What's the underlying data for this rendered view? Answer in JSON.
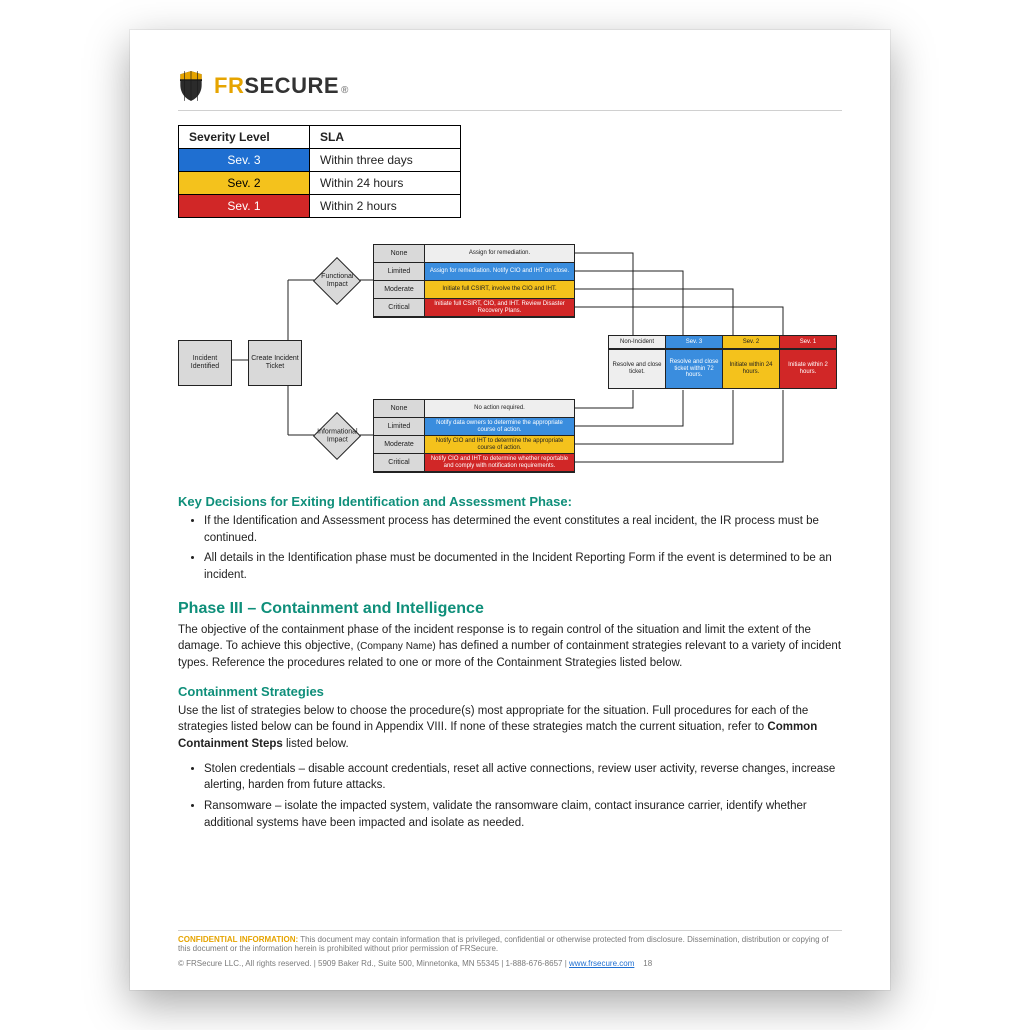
{
  "brand": {
    "fr": "FR",
    "sec": "SECURE",
    "reg": "®"
  },
  "sla_table": {
    "headers": [
      "Severity Level",
      "SLA"
    ],
    "rows": [
      {
        "level": "Sev. 3",
        "sla": "Within three days",
        "class": "sev3"
      },
      {
        "level": "Sev. 2",
        "sla": "Within 24 hours",
        "class": "sev2"
      },
      {
        "level": "Sev. 1",
        "sla": "Within 2 hours",
        "class": "sev1"
      }
    ]
  },
  "flow": {
    "incident_identified": "Incident Identified",
    "create_ticket": "Create Incident Ticket",
    "functional_impact": "Functional Impact",
    "informational_impact": "Informational Impact",
    "impact_levels": [
      "None",
      "Limited",
      "Moderate",
      "Critical"
    ],
    "functional_actions": [
      "Assign for remediation.",
      "Assign for remediation. Notify CIO and IHT on close.",
      "Initiate full CSIRT, involve the CIO and IHT.",
      "Initiate full CSIRT, CIO, and IHT. Review Disaster Recovery Plans."
    ],
    "informational_actions": [
      "No action required.",
      "Notify data owners to determine the appropriate course of action.",
      "Notify CIO and IHT to determine the appropriate course of action.",
      "Notify CIO and IHT to determine whether reportable and comply with notification requirements."
    ],
    "sev_header": [
      "Non-Incident",
      "Sev. 3",
      "Sev. 2",
      "Sev. 1"
    ],
    "sev_text": [
      "Resolve and close ticket.",
      "Resolve and close ticket within 72 hours.",
      "Initiate within 24 hours.",
      "Initiate within 2 hours."
    ]
  },
  "key_decisions": {
    "title": "Key Decisions for Exiting Identification and Assessment Phase:",
    "items": [
      "If the Identification and Assessment process has determined the event constitutes a real incident, the IR process must be continued.",
      "All details in the Identification phase must be documented in the Incident Reporting Form if the event is determined to be an incident."
    ]
  },
  "phase3": {
    "title": "Phase III – Containment and Intelligence",
    "para_a": "The objective of the containment phase of the incident response is to regain control of the situation and limit the extent of the damage.  To achieve this objective, ",
    "placeholder": "(Company Name)",
    "para_b": " has defined a number of containment strategies relevant to a variety of incident types. Reference the procedures related to one or more of the Containment Strategies listed below."
  },
  "containment": {
    "title": "Containment Strategies",
    "para_a": "Use the list of strategies below to choose the procedure(s) most appropriate for the situation. Full procedures for each of the strategies listed below can be found in Appendix VIII. If none of these strategies match the current situation, refer to ",
    "bold": "Common Containment Steps",
    "para_b": " listed below.",
    "items": [
      "Stolen credentials – disable account credentials, reset all active connections, review user activity, reverse changes, increase alerting, harden from future attacks.",
      "Ransomware – isolate the impacted system, validate the ransomware claim, contact insurance carrier, identify whether additional systems have been impacted and isolate as needed."
    ]
  },
  "footer": {
    "conf_label": "CONFIDENTIAL INFORMATION:",
    "conf_text": " This document may contain information that is privileged, confidential or otherwise protected from disclosure. Dissemination, distribution or copying of this document or the information herein is prohibited without prior permission of FRSecure.",
    "copyright": "© FRSecure LLC., All rights reserved. | 5909 Baker Rd., Suite 500, Minnetonka, MN 55345 | 1-888-676-8657 | ",
    "link": "www.frsecure.com",
    "page": "18"
  }
}
